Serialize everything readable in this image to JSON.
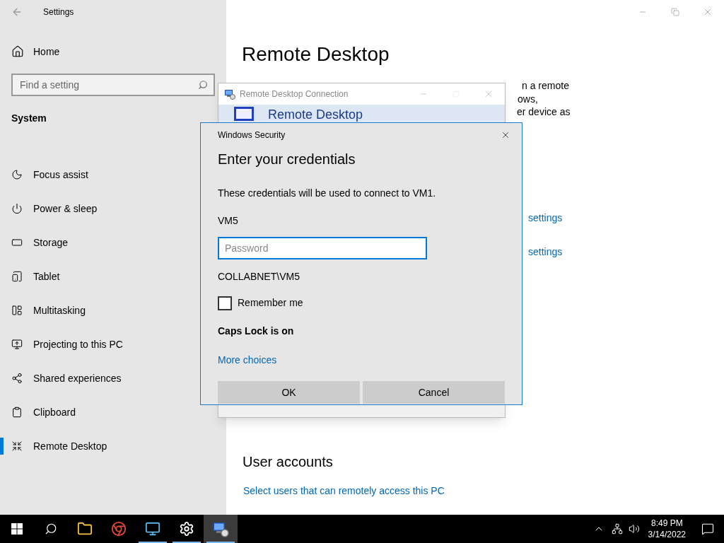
{
  "settings_window": {
    "title": "Settings",
    "home": "Home",
    "search": {
      "placeholder": "Find a setting"
    },
    "section": "System",
    "nav_items": [
      {
        "label": "Focus assist",
        "selected": false
      },
      {
        "label": "Power & sleep",
        "selected": false
      },
      {
        "label": "Storage",
        "selected": false
      },
      {
        "label": "Tablet",
        "selected": false
      },
      {
        "label": "Multitasking",
        "selected": false
      },
      {
        "label": "Projecting to this PC",
        "selected": false
      },
      {
        "label": "Shared experiences",
        "selected": false
      },
      {
        "label": "Clipboard",
        "selected": false
      },
      {
        "label": "Remote Desktop",
        "selected": true
      }
    ],
    "page_title": "Remote Desktop",
    "text_fragments": [
      "n a remote",
      "ows,",
      "er device as"
    ],
    "links": [
      "settings",
      "settings"
    ],
    "user_accounts": {
      "heading": "User accounts",
      "link": "Select users that can remotely access this PC"
    }
  },
  "rdc_window": {
    "title": "Remote Desktop Connection",
    "banner": "Remote Desktop"
  },
  "security_dialog": {
    "title": "Windows Security",
    "heading": "Enter your credentials",
    "message": "These credentials will be used to connect to VM1.",
    "user": "VM5",
    "password": {
      "placeholder": "Password"
    },
    "domain_user": "COLLABNET\\VM5",
    "remember": {
      "label": "Remember me",
      "checked": false
    },
    "caps_warning": "Caps Lock is on",
    "more_choices": "More choices",
    "buttons": [
      "OK",
      "Cancel"
    ]
  },
  "taskbar": {
    "apps": [
      {
        "running": false,
        "selected": false
      },
      {
        "running": false,
        "selected": false
      },
      {
        "running": true,
        "selected": false
      },
      {
        "running": true,
        "selected": false
      },
      {
        "running": true,
        "selected": true
      }
    ],
    "time": "8:49 PM",
    "date": "3/14/2022"
  }
}
